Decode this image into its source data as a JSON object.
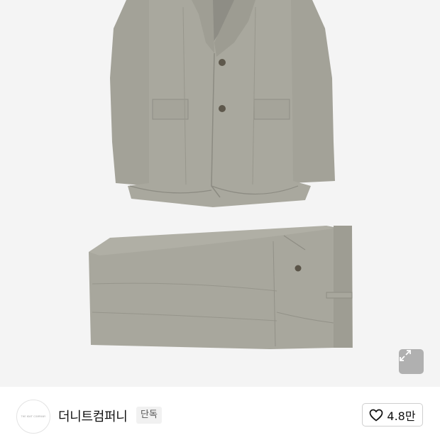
{
  "product": {
    "image_alt": "grey suit jacket and trousers",
    "expand_icon": "expand-icon"
  },
  "shop": {
    "logo_text": "THE KNIT COMPANY",
    "name": "더니트컴퍼니",
    "badge": "단독"
  },
  "like": {
    "icon": "heart-icon",
    "count": "4.8만"
  },
  "colors": {
    "background": "#f4f4f4",
    "suit": "#a7a69c"
  }
}
